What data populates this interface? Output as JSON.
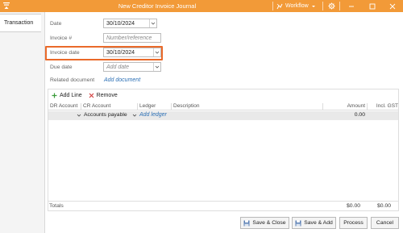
{
  "window": {
    "title": "New Creditor Invoice Journal",
    "workflow_label": "Workflow"
  },
  "tabs": [
    {
      "label": "Transaction"
    }
  ],
  "form": {
    "date": {
      "label": "Date",
      "value": "30/10/2024"
    },
    "invoice_no": {
      "label": "Invoice #",
      "placeholder": "Number/reference"
    },
    "invoice_date": {
      "label": "Invoice date",
      "value": "30/10/2024"
    },
    "due_date": {
      "label": "Due date",
      "placeholder": "Add date"
    },
    "related_document": {
      "label": "Related document",
      "link": "Add document"
    }
  },
  "grid": {
    "toolbar": {
      "add_line": "Add Line",
      "remove": "Remove"
    },
    "columns": [
      "DR Account",
      "CR Account",
      "Ledger",
      "Description",
      "Amount",
      "Incl. GST"
    ],
    "rows": [
      {
        "dr_account": "",
        "cr_account": "Accounts payable",
        "ledger_link": "Add ledger",
        "description": "",
        "amount": "0.00",
        "incl_gst": ""
      }
    ],
    "totals": {
      "label": "Totals",
      "amount": "$0.00",
      "incl_gst": "$0.00"
    }
  },
  "footer": {
    "save_close": "Save & Close",
    "save_add": "Save & Add",
    "process": "Process",
    "cancel": "Cancel"
  },
  "colors": {
    "titlebar": "#f29a38",
    "highlight": "#ea6a2a",
    "link": "#2b6fb5"
  }
}
